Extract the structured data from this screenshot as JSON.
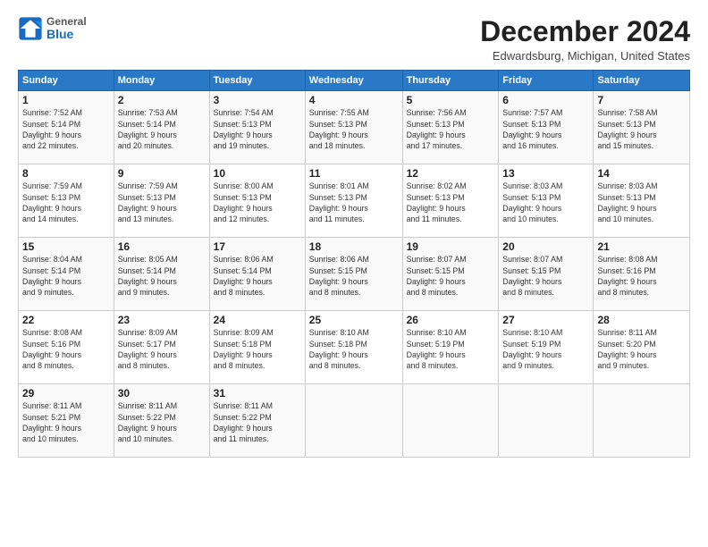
{
  "logo": {
    "general": "General",
    "blue": "Blue"
  },
  "title": "December 2024",
  "location": "Edwardsburg, Michigan, United States",
  "days_header": [
    "Sunday",
    "Monday",
    "Tuesday",
    "Wednesday",
    "Thursday",
    "Friday",
    "Saturday"
  ],
  "weeks": [
    [
      {
        "day": "1",
        "info": "Sunrise: 7:52 AM\nSunset: 5:14 PM\nDaylight: 9 hours\nand 22 minutes."
      },
      {
        "day": "2",
        "info": "Sunrise: 7:53 AM\nSunset: 5:14 PM\nDaylight: 9 hours\nand 20 minutes."
      },
      {
        "day": "3",
        "info": "Sunrise: 7:54 AM\nSunset: 5:13 PM\nDaylight: 9 hours\nand 19 minutes."
      },
      {
        "day": "4",
        "info": "Sunrise: 7:55 AM\nSunset: 5:13 PM\nDaylight: 9 hours\nand 18 minutes."
      },
      {
        "day": "5",
        "info": "Sunrise: 7:56 AM\nSunset: 5:13 PM\nDaylight: 9 hours\nand 17 minutes."
      },
      {
        "day": "6",
        "info": "Sunrise: 7:57 AM\nSunset: 5:13 PM\nDaylight: 9 hours\nand 16 minutes."
      },
      {
        "day": "7",
        "info": "Sunrise: 7:58 AM\nSunset: 5:13 PM\nDaylight: 9 hours\nand 15 minutes."
      }
    ],
    [
      {
        "day": "8",
        "info": "Sunrise: 7:59 AM\nSunset: 5:13 PM\nDaylight: 9 hours\nand 14 minutes."
      },
      {
        "day": "9",
        "info": "Sunrise: 7:59 AM\nSunset: 5:13 PM\nDaylight: 9 hours\nand 13 minutes."
      },
      {
        "day": "10",
        "info": "Sunrise: 8:00 AM\nSunset: 5:13 PM\nDaylight: 9 hours\nand 12 minutes."
      },
      {
        "day": "11",
        "info": "Sunrise: 8:01 AM\nSunset: 5:13 PM\nDaylight: 9 hours\nand 11 minutes."
      },
      {
        "day": "12",
        "info": "Sunrise: 8:02 AM\nSunset: 5:13 PM\nDaylight: 9 hours\nand 11 minutes."
      },
      {
        "day": "13",
        "info": "Sunrise: 8:03 AM\nSunset: 5:13 PM\nDaylight: 9 hours\nand 10 minutes."
      },
      {
        "day": "14",
        "info": "Sunrise: 8:03 AM\nSunset: 5:13 PM\nDaylight: 9 hours\nand 10 minutes."
      }
    ],
    [
      {
        "day": "15",
        "info": "Sunrise: 8:04 AM\nSunset: 5:14 PM\nDaylight: 9 hours\nand 9 minutes."
      },
      {
        "day": "16",
        "info": "Sunrise: 8:05 AM\nSunset: 5:14 PM\nDaylight: 9 hours\nand 9 minutes."
      },
      {
        "day": "17",
        "info": "Sunrise: 8:06 AM\nSunset: 5:14 PM\nDaylight: 9 hours\nand 8 minutes."
      },
      {
        "day": "18",
        "info": "Sunrise: 8:06 AM\nSunset: 5:15 PM\nDaylight: 9 hours\nand 8 minutes."
      },
      {
        "day": "19",
        "info": "Sunrise: 8:07 AM\nSunset: 5:15 PM\nDaylight: 9 hours\nand 8 minutes."
      },
      {
        "day": "20",
        "info": "Sunrise: 8:07 AM\nSunset: 5:15 PM\nDaylight: 9 hours\nand 8 minutes."
      },
      {
        "day": "21",
        "info": "Sunrise: 8:08 AM\nSunset: 5:16 PM\nDaylight: 9 hours\nand 8 minutes."
      }
    ],
    [
      {
        "day": "22",
        "info": "Sunrise: 8:08 AM\nSunset: 5:16 PM\nDaylight: 9 hours\nand 8 minutes."
      },
      {
        "day": "23",
        "info": "Sunrise: 8:09 AM\nSunset: 5:17 PM\nDaylight: 9 hours\nand 8 minutes."
      },
      {
        "day": "24",
        "info": "Sunrise: 8:09 AM\nSunset: 5:18 PM\nDaylight: 9 hours\nand 8 minutes."
      },
      {
        "day": "25",
        "info": "Sunrise: 8:10 AM\nSunset: 5:18 PM\nDaylight: 9 hours\nand 8 minutes."
      },
      {
        "day": "26",
        "info": "Sunrise: 8:10 AM\nSunset: 5:19 PM\nDaylight: 9 hours\nand 8 minutes."
      },
      {
        "day": "27",
        "info": "Sunrise: 8:10 AM\nSunset: 5:19 PM\nDaylight: 9 hours\nand 9 minutes."
      },
      {
        "day": "28",
        "info": "Sunrise: 8:11 AM\nSunset: 5:20 PM\nDaylight: 9 hours\nand 9 minutes."
      }
    ],
    [
      {
        "day": "29",
        "info": "Sunrise: 8:11 AM\nSunset: 5:21 PM\nDaylight: 9 hours\nand 10 minutes."
      },
      {
        "day": "30",
        "info": "Sunrise: 8:11 AM\nSunset: 5:22 PM\nDaylight: 9 hours\nand 10 minutes."
      },
      {
        "day": "31",
        "info": "Sunrise: 8:11 AM\nSunset: 5:22 PM\nDaylight: 9 hours\nand 11 minutes."
      },
      {
        "day": "",
        "info": ""
      },
      {
        "day": "",
        "info": ""
      },
      {
        "day": "",
        "info": ""
      },
      {
        "day": "",
        "info": ""
      }
    ]
  ]
}
